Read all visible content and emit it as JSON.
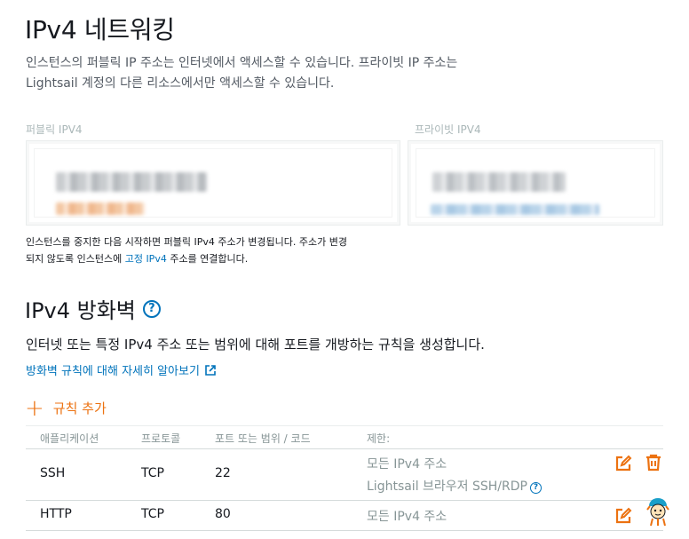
{
  "page": {
    "title": "IPv4 네트워킹",
    "intro_line1": "인스턴스의 퍼블릭 IP 주소는 인터넷에서 액세스할 수 있습니다. 프라이빗 IP 주소는",
    "intro_line2": "Lightsail 계정의 다른 리소스에서만 액세스할 수 있습니다."
  },
  "public_ip": {
    "label": "퍼블릭 IPV4"
  },
  "private_ip": {
    "label": "프라이빗 IPV4"
  },
  "note": {
    "text1": "인스턴스를 중지한 다음 시작하면 퍼블릭 IPv4 주소가 변경됩니다. 주소가 변경",
    "text2_pre": "되지 않도록 인스턴스에 ",
    "link": "고정 IPv4",
    "text2_post": " 주소를 연결합니다."
  },
  "firewall": {
    "title": "IPv4 방화벽",
    "help_glyph": "?",
    "description": "인터넷 또는 특정 IPv4 주소 또는 범위에 대해 포트를 개방하는 규칙을 생성합니다.",
    "learn_more": "방화벽 규칙에 대해 자세히 알아보기",
    "add_rule": "규칙 추가",
    "columns": {
      "application": "애플리케이션",
      "protocol": "프로토콜",
      "port": "포트 또는 범위 / 코드",
      "restriction": "제한:"
    },
    "rows": [
      {
        "application": "SSH",
        "protocol": "TCP",
        "port": "22",
        "restriction1": "모든 IPv4 주소",
        "restriction2": "Lightsail 브라우저 SSH/RDP"
      },
      {
        "application": "HTTP",
        "protocol": "TCP",
        "port": "80",
        "restriction1": "모든 IPv4 주소"
      }
    ]
  },
  "colors": {
    "accent": "#ec7211",
    "link": "#0073bb",
    "muted": "#879596"
  },
  "icons": [
    "plus-icon",
    "help-icon",
    "external-link-icon",
    "edit-icon",
    "trash-icon"
  ]
}
